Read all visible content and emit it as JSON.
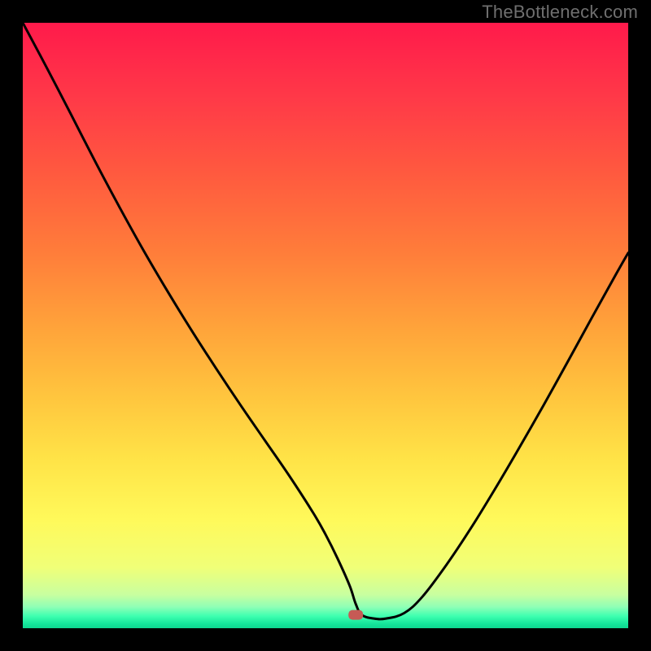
{
  "watermark": "TheBottleneck.com",
  "chart_data": {
    "type": "line",
    "title": "",
    "xlabel": "",
    "ylabel": "",
    "xlim": [
      0,
      100
    ],
    "ylim": [
      0,
      100
    ],
    "grid": false,
    "annotations": [],
    "series": [
      {
        "name": "curve",
        "x": [
          0,
          4,
          8,
          12,
          16,
          20,
          24,
          28,
          32,
          36,
          40,
          44,
          48,
          50,
          52,
          54,
          55,
          56,
          58,
          60,
          63,
          66,
          70,
          74,
          78,
          82,
          86,
          90,
          94,
          98,
          100
        ],
        "values": [
          100,
          92.5,
          84.8,
          77,
          69.5,
          62.3,
          55.5,
          49,
          42.8,
          36.8,
          31,
          25.2,
          19,
          15.5,
          11.5,
          7,
          4,
          2.2,
          1.6,
          1.6,
          2.5,
          5.2,
          10.5,
          16.5,
          23,
          29.8,
          36.8,
          44,
          51.3,
          58.5,
          62
        ]
      }
    ],
    "minimum_marker": {
      "x": 55,
      "y": 2.2
    },
    "background": {
      "type": "vertical_gradient",
      "stops": [
        {
          "pos": 0.0,
          "color": "#ff1a4b"
        },
        {
          "pos": 0.12,
          "color": "#ff3848"
        },
        {
          "pos": 0.25,
          "color": "#ff5a3f"
        },
        {
          "pos": 0.38,
          "color": "#ff7d3a"
        },
        {
          "pos": 0.5,
          "color": "#ffa23a"
        },
        {
          "pos": 0.62,
          "color": "#ffc63e"
        },
        {
          "pos": 0.72,
          "color": "#ffe347"
        },
        {
          "pos": 0.82,
          "color": "#fff95a"
        },
        {
          "pos": 0.9,
          "color": "#f0ff78"
        },
        {
          "pos": 0.945,
          "color": "#c8ffa0"
        },
        {
          "pos": 0.965,
          "color": "#8effb6"
        },
        {
          "pos": 0.98,
          "color": "#3effb0"
        },
        {
          "pos": 0.993,
          "color": "#14e59a"
        },
        {
          "pos": 1.0,
          "color": "#0fd690"
        }
      ]
    }
  }
}
